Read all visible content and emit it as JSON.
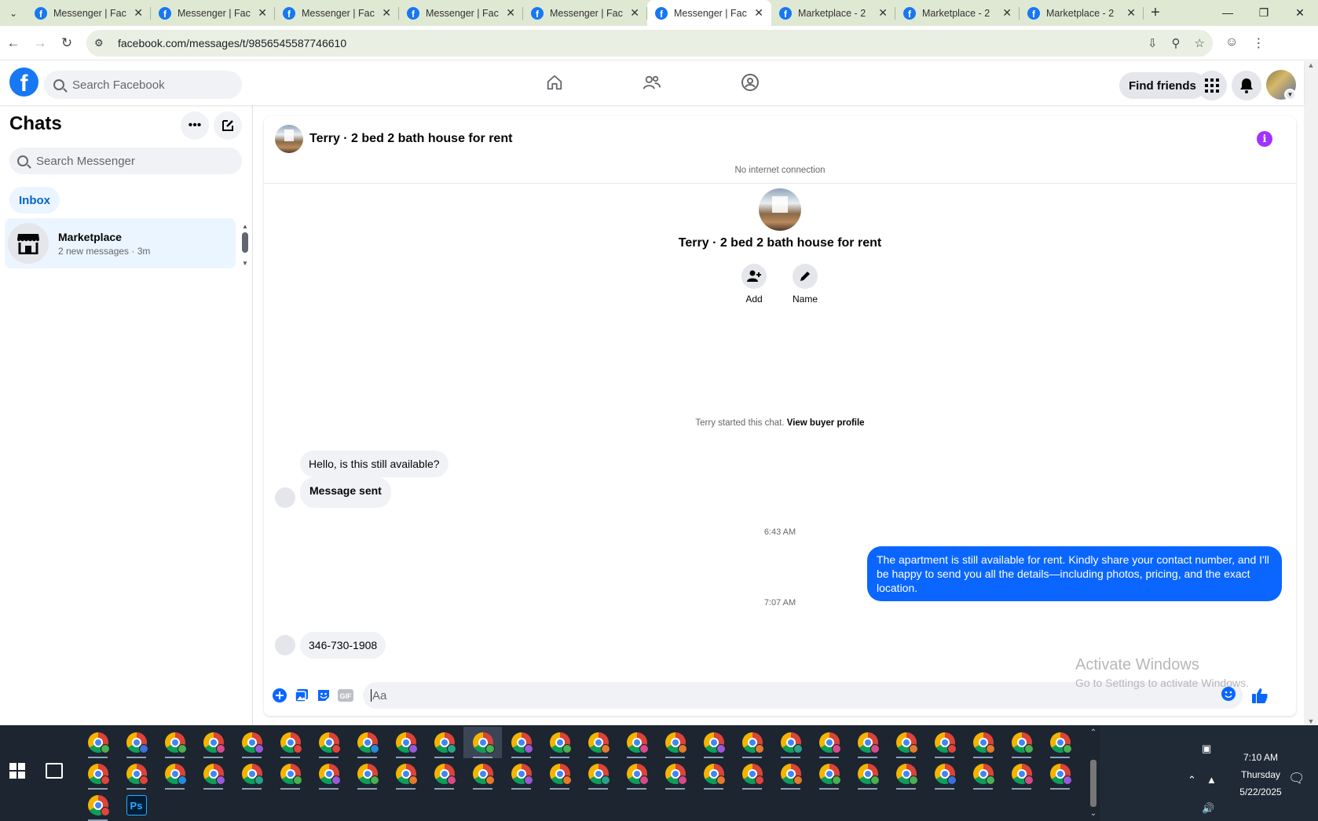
{
  "browser": {
    "tabs": [
      {
        "title": "Messenger | Fac",
        "active": false
      },
      {
        "title": "Messenger | Fac",
        "active": false
      },
      {
        "title": "Messenger | Fac",
        "active": false
      },
      {
        "title": "Messenger | Fac",
        "active": false
      },
      {
        "title": "Messenger | Fac",
        "active": false
      },
      {
        "title": "Messenger | Fac",
        "active": true
      },
      {
        "title": "Marketplace - 2",
        "active": false
      },
      {
        "title": "Marketplace - 2",
        "active": false
      },
      {
        "title": "Marketplace - 2",
        "active": false
      }
    ],
    "url": "facebook.com/messages/t/9856545587746610"
  },
  "fb_header": {
    "search_placeholder": "Search Facebook",
    "find_friends": "Find friends"
  },
  "sidebar": {
    "title": "Chats",
    "search_placeholder": "Search Messenger",
    "filter": "Inbox",
    "chats": [
      {
        "name": "Marketplace",
        "preview": "2 new messages · 3m"
      }
    ]
  },
  "conversation": {
    "title": "Terry · 2 bed 2 bath house for rent",
    "status": "No internet connection",
    "actions": {
      "add": "Add",
      "name": "Name"
    },
    "started_text": "Terry started this chat.",
    "started_link": "View buyer profile",
    "messages": [
      {
        "from": "them",
        "text": "Hello, is this still available?"
      },
      {
        "from": "them",
        "text": "Message sent"
      },
      {
        "time": "6:43 AM"
      },
      {
        "from": "me",
        "text": "The apartment is still available for rent. Kindly share your contact number, and I'll be happy to send you all the details—including photos, pricing, and the exact location."
      },
      {
        "time": "7:07 AM"
      },
      {
        "from": "them",
        "text": "346-730-1908"
      }
    ],
    "composer_placeholder": "Aa"
  },
  "watermark": {
    "line1": "Activate Windows",
    "line2": "Go to Settings to activate Windows."
  },
  "taskbar": {
    "time": "7:10 AM",
    "day": "Thursday",
    "date": "5/22/2025",
    "profile_colors": [
      "#4caf50",
      "#3f6fd8",
      "#4caf50",
      "#d84a8a",
      "#9b59d6",
      "#e0443c",
      "#e0443c",
      "#2b8ad8",
      "#9b59d6",
      "#2aa28a",
      "#4caf50",
      "#9b59d6",
      "#4caf50",
      "#e57a2c",
      "#d84a8a",
      "#e57a2c",
      "#9b59d6",
      "#e57a2c",
      "#2aa28a",
      "#d84a8a",
      "#d84a8a",
      "#e57a2c",
      "#e0443c",
      "#e57a2c",
      "#4caf50",
      "#4caf50"
    ],
    "colors": {
      "accent": "#1877f2",
      "outgoing_bubble": "#0a66ff"
    }
  }
}
